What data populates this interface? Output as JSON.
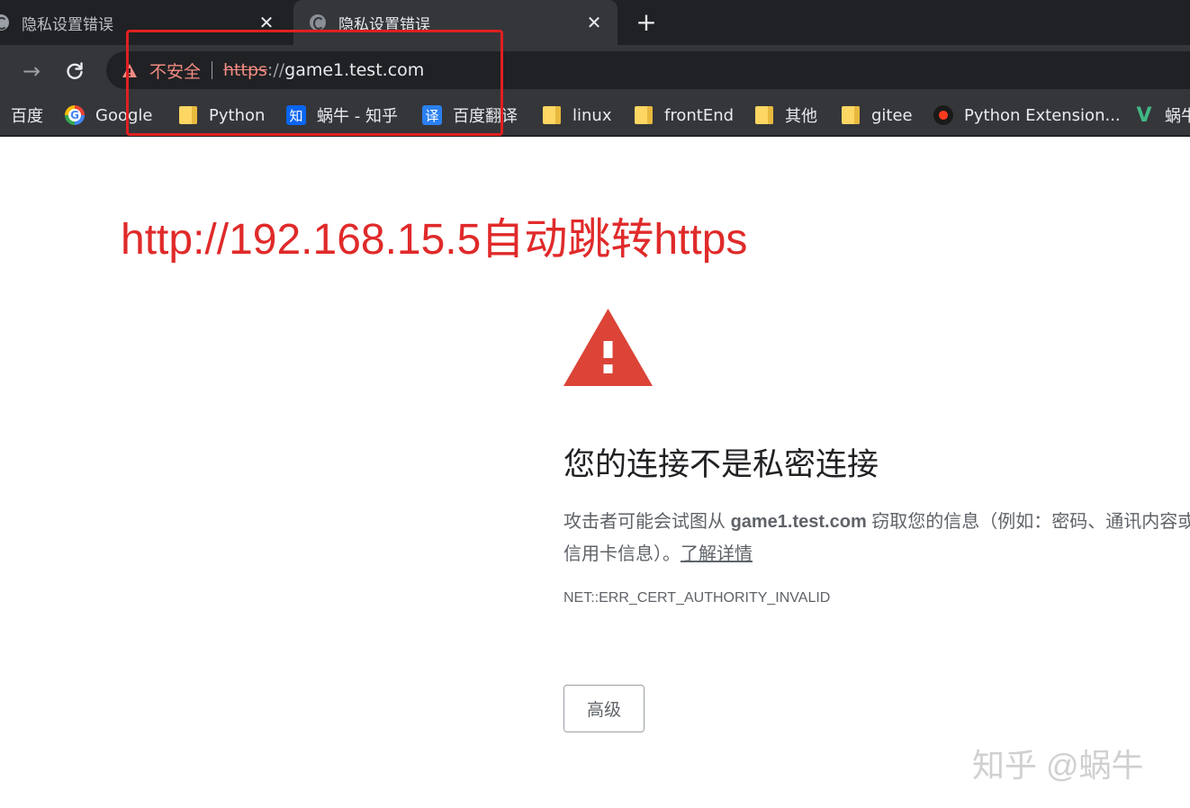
{
  "tabs": [
    {
      "title": "隐私设置错误",
      "close": "✕",
      "active": false
    },
    {
      "title": "隐私设置错误",
      "close": "✕",
      "active": true
    }
  ],
  "new_tab_label": "+",
  "toolbar": {
    "forward_icon": "→",
    "reload_icon": "⟳",
    "security_label": "不安全",
    "url_scheme": "https",
    "url_separator": "://",
    "url_host": "game1.test.com"
  },
  "bookmarks": [
    {
      "label": "百度",
      "icon": "none"
    },
    {
      "label": "Google",
      "icon": "google-icon"
    },
    {
      "label": "Python",
      "icon": "folder-icon"
    },
    {
      "label": "蜗牛 - 知乎",
      "icon": "zhihu-icon",
      "badge": "知"
    },
    {
      "label": "百度翻译",
      "icon": "fanyi-icon",
      "badge": "译"
    },
    {
      "label": "linux",
      "icon": "folder-icon"
    },
    {
      "label": "frontEnd",
      "icon": "folder-icon"
    },
    {
      "label": "其他",
      "icon": "folder-icon"
    },
    {
      "label": "gitee",
      "icon": "folder-icon"
    },
    {
      "label": "Python Extension...",
      "icon": "extension-icon"
    },
    {
      "label": "蜗牛",
      "icon": "vue-icon",
      "badge": "V"
    }
  ],
  "annotation": {
    "text": "http://192.168.15.5自动跳转https",
    "color": "#e02a2a"
  },
  "interstitial": {
    "heading": "您的连接不是私密连接",
    "desc_prefix": "攻击者可能会试图从 ",
    "desc_host": "game1.test.com",
    "desc_suffix": " 窃取您的信息（例如：密码、通讯内容或信用卡信息）。",
    "learn_more": "了解详情",
    "error_code": "NET::ERR_CERT_AUTHORITY_INVALID",
    "advanced_button": "高级"
  },
  "watermark": "知乎 @蜗牛",
  "colors": {
    "warning_red": "#db4437",
    "insecure_text": "#f28b82",
    "chrome_dark": "#202124",
    "chrome_toolbar": "#35363a"
  }
}
